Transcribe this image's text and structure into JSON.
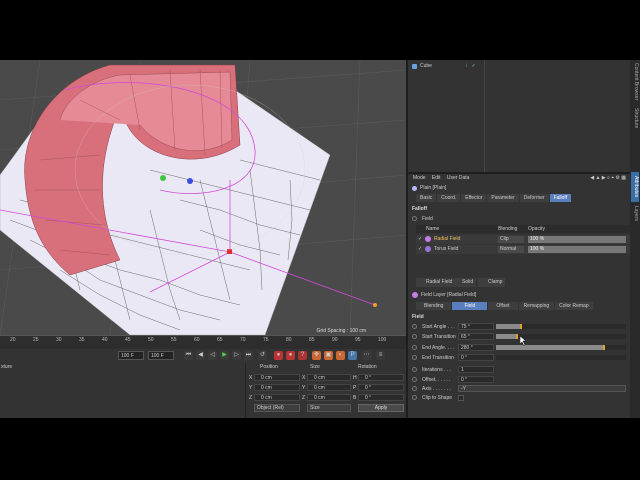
{
  "viewport": {
    "grid_spacing": "Grid Spacing : 100 cm"
  },
  "timeline": {
    "ticks": [
      "20",
      "25",
      "30",
      "35",
      "40",
      "45",
      "50",
      "55",
      "60",
      "65",
      "70",
      "75",
      "80",
      "85",
      "90",
      "95",
      "100"
    ],
    "current_frame": "100 F",
    "end_frame": "100 F"
  },
  "material": {
    "label": "xture"
  },
  "coords": {
    "headers": [
      "Position",
      "Size",
      "Rotation"
    ],
    "rows": [
      {
        "axis": "X",
        "pos": "0 cm",
        "size": "0 cm",
        "rot_axis": "H",
        "rot": "0 °"
      },
      {
        "axis": "Y",
        "pos": "0 cm",
        "size": "0 cm",
        "rot_axis": "P",
        "rot": "0 °"
      },
      {
        "axis": "Z",
        "pos": "0 cm",
        "size": "0 cm",
        "rot_axis": "B",
        "rot": "0 °"
      }
    ],
    "mode": "Object (Rel)",
    "size_mode": "Size",
    "apply": "Apply"
  },
  "object_manager": {
    "object_name": "Cube"
  },
  "attributes": {
    "menu": [
      "Mode",
      "Edit",
      "User Data"
    ],
    "title": "Plain [Plain]",
    "tabs": [
      "Basic",
      "Coord.",
      "Effector",
      "Parameter",
      "Deformer",
      "Falloff"
    ],
    "active_tab": "Falloff",
    "section_falloff": "Falloff",
    "section_field": "Field",
    "columns": {
      "name": "Name",
      "blending": "Blending",
      "opacity": "Opacity"
    },
    "fields": [
      {
        "name": "Radial Field",
        "blend": "Clip",
        "opacity": "100 %",
        "color": "#c77be6"
      },
      {
        "name": "Torus Field",
        "blend": "Normal",
        "opacity": "100 %",
        "color": "#9a72e0"
      }
    ],
    "field_buttons": [
      "Radial Field",
      "Solid",
      "Clamp"
    ],
    "layer_title": "Field Layer [Radial Field]",
    "layer_tabs": [
      "Blending",
      "Field",
      "Offset",
      "Remapping",
      "Color Remap"
    ],
    "layer_active_tab": "Field",
    "field_section": "Field",
    "params": [
      {
        "label": "Start Angle . . .",
        "value": "75 °",
        "fill": 0.2
      },
      {
        "label": "Start Transition",
        "value": "65 °",
        "fill": 0.17
      },
      {
        "label": "End Angle. . . .",
        "value": "280 °",
        "fill": 0.84
      },
      {
        "label": "End Transition",
        "value": "0 °",
        "fill": 0.0
      },
      {
        "label": "Iterations . . .",
        "value": "1",
        "fill": null
      },
      {
        "label": "Offset. . . . . .",
        "value": "0 °",
        "fill": null
      },
      {
        "label": "Axis . . . . . . .",
        "value": "-Y",
        "fill": null
      },
      {
        "label": "Clip to Shape",
        "value": "",
        "fill": null
      }
    ]
  },
  "side_tabs": [
    "Content Browser",
    "Structure",
    "Attributes",
    "Layers"
  ],
  "side_active": "Attributes",
  "colors": {
    "accent": "#5a7fbf",
    "mesh_pink": "#d8707c",
    "floor": "#eceaf6"
  }
}
